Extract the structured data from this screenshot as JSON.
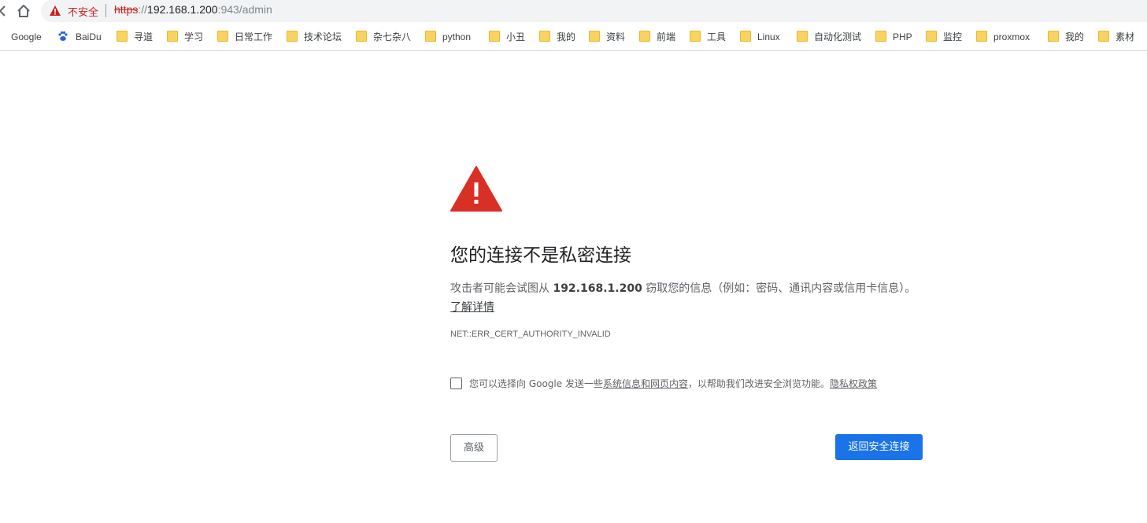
{
  "address_bar": {
    "security_label": "不安全",
    "url_scheme": "https",
    "url_sep": "://",
    "url_host": "192.168.1.200",
    "url_rest": ":943/admin"
  },
  "bookmarks": [
    {
      "label": "Google",
      "icon": "google-icon"
    },
    {
      "label": "BaiDu",
      "icon": "baidu-paw-icon"
    },
    {
      "label": "寻道",
      "icon": "folder-icon"
    },
    {
      "label": "学习",
      "icon": "folder-icon"
    },
    {
      "label": "日常工作",
      "icon": "folder-icon"
    },
    {
      "label": "技术论坛",
      "icon": "folder-icon"
    },
    {
      "label": "杂七杂八",
      "icon": "folder-icon"
    },
    {
      "label": "python",
      "icon": "folder-icon"
    },
    {
      "label": "小丑",
      "icon": "folder-icon"
    },
    {
      "label": "我的",
      "icon": "folder-icon"
    },
    {
      "label": "资料",
      "icon": "folder-icon"
    },
    {
      "label": "前端",
      "icon": "folder-icon"
    },
    {
      "label": "工具",
      "icon": "folder-icon"
    },
    {
      "label": "Linux",
      "icon": "folder-icon"
    },
    {
      "label": "自动化测试",
      "icon": "folder-icon"
    },
    {
      "label": "PHP",
      "icon": "folder-icon"
    },
    {
      "label": "监控",
      "icon": "folder-icon"
    },
    {
      "label": "proxmox",
      "icon": "folder-icon"
    },
    {
      "label": "我的",
      "icon": "folder-icon"
    },
    {
      "label": "素材",
      "icon": "folder-icon"
    }
  ],
  "interstitial": {
    "heading": "您的连接不是私密连接",
    "desc_before": "攻击者可能会试图从 ",
    "desc_host": "192.168.1.200",
    "desc_after": " 窃取您的信息（例如：密码、通讯内容或信用卡信息）。",
    "learn_more": "了解详情",
    "error_code": "NET::ERR_CERT_AUTHORITY_INVALID",
    "optin_before": "您可以选择向 Google 发送一些",
    "optin_link": "系统信息和网页内容",
    "optin_after": "，以帮助我们改进安全浏览功能。",
    "privacy_link": "隐私权政策",
    "advanced_button": "高级",
    "back_button": "返回安全连接"
  },
  "colors": {
    "danger": "#d93025",
    "primary_button": "#1a73e8",
    "folder": "#f9d35f"
  }
}
